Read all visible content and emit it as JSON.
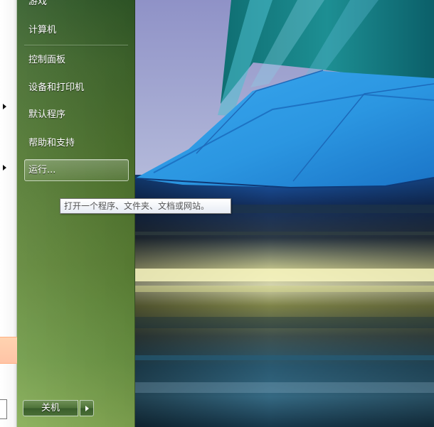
{
  "start_menu": {
    "items": [
      {
        "label": "游戏"
      },
      {
        "label": "计算机"
      },
      {
        "label": "控制面板"
      },
      {
        "label": "设备和打印机"
      },
      {
        "label": "默认程序"
      },
      {
        "label": "帮助和支持"
      }
    ],
    "run": {
      "label": "运行..."
    },
    "tooltip": "打开一个程序、文件夹、文档或网站。",
    "shutdown": {
      "label": "关机"
    }
  },
  "icons": {
    "left_arrows": [
      "arrow-right-icon",
      "arrow-right-icon"
    ],
    "shutdown_arrow": "shutdown-arrow-icon"
  },
  "colors": {
    "menu_green": "#50772f",
    "tooltip_border": "#767676",
    "accent_blue": "#2ea6e6",
    "left_orange": "#ffc4a6"
  }
}
